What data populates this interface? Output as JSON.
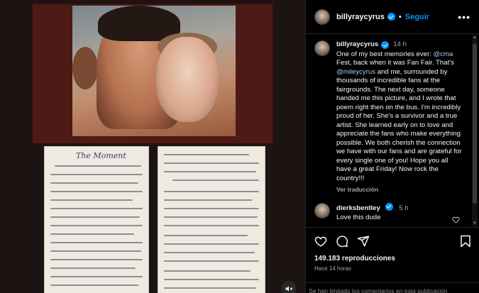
{
  "post": {
    "username": "billyraycyrus",
    "follow_label": "Seguir",
    "more_label": "•••",
    "dot": "•",
    "caption": {
      "username": "billyraycyrus",
      "time": "14 h",
      "text_1": "One of my best memories ever: ",
      "mention_1": "@cma",
      "text_2": " Fest, back when it was Fan Fair. That's ",
      "mention_2": "@mileycyrus",
      "text_3": " and me, surrounded by thousands of incredible fans at the fairgrounds. The next day, someone handed me this picture, and I wrote that poem right then on the bus. I'm incredibly proud of her. She's a survivor and a true artist. She learned early on to love and appreciate the fans who make everything possible. We both cherish the connection we have with our fans and are grateful for every single one of you! Hope you all have a great Friday! Now rock the country!!!",
      "translate_label": "Ver traducción"
    },
    "comments": [
      {
        "username": "dierksbentley",
        "time": "5 h",
        "text": "Love this dude"
      }
    ],
    "views": "149.183 reproducciones",
    "posted_ago": "Hace 14 horas",
    "limited_notice": "Se han limitado los comentarios en esta publicación"
  },
  "media": {
    "poem_title": "The Moment"
  },
  "icons": {
    "like": "heart-icon",
    "comment": "comment-icon",
    "share": "share-icon",
    "save": "bookmark-icon",
    "mute": "mute-icon"
  },
  "colors": {
    "accent": "#0095f6",
    "mention": "#a3c9f5",
    "frame_mat": "#4e1a16",
    "ink": "#3d3f63"
  }
}
